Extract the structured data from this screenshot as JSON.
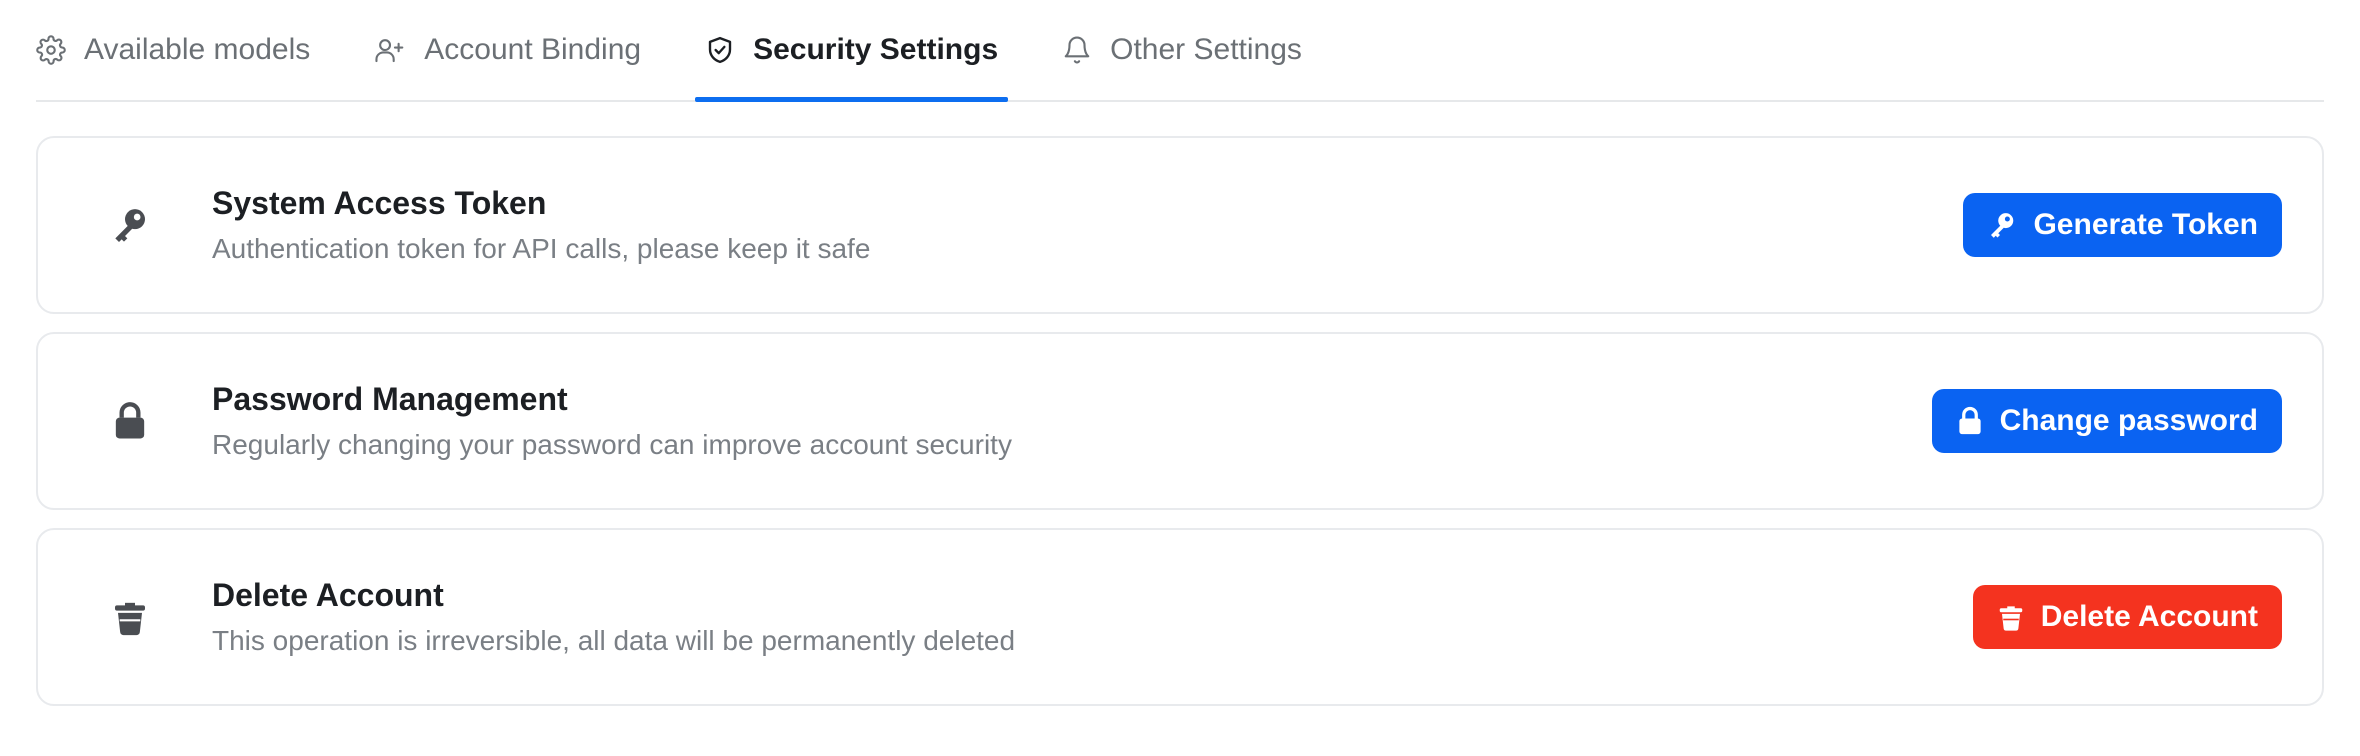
{
  "tabs": [
    {
      "label": "Available models",
      "icon": "gear-icon",
      "active": false
    },
    {
      "label": "Account Binding",
      "icon": "user-plus-icon",
      "active": false
    },
    {
      "label": "Security Settings",
      "icon": "shield-check-icon",
      "active": true
    },
    {
      "label": "Other Settings",
      "icon": "bell-icon",
      "active": false
    }
  ],
  "cards": {
    "token": {
      "icon": "key-icon",
      "title": "System Access Token",
      "description": "Authentication token for API calls, please keep it safe",
      "button_label": "Generate Token",
      "button_icon": "key-icon"
    },
    "password": {
      "icon": "lock-icon",
      "title": "Password Management",
      "description": "Regularly changing your password can improve account security",
      "button_label": "Change password",
      "button_icon": "lock-icon"
    },
    "delete": {
      "icon": "trash-icon",
      "title": "Delete Account",
      "description": "This operation is irreversible, all data will be permanently deleted",
      "button_label": "Delete Account",
      "button_icon": "trash-icon"
    }
  },
  "colors": {
    "accent": "#0a63f2",
    "danger": "#f4331f",
    "active_tab_underline": "#0d6ef0"
  }
}
